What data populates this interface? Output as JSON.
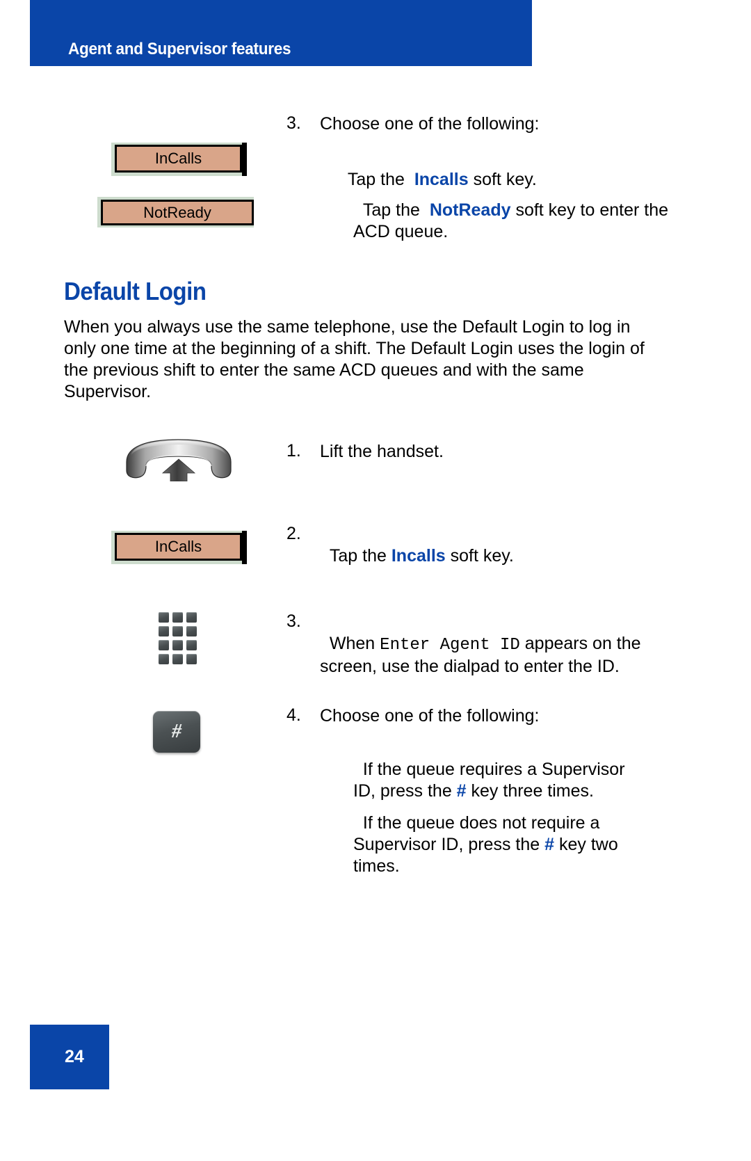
{
  "header": {
    "title": "Agent and Supervisor features",
    "bar_color": "#0A45A8"
  },
  "top_step": {
    "number": "3.",
    "text": "Choose one of the following:",
    "bullets": [
      {
        "prefix": "Tap the  ",
        "highlight": "Incalls",
        "suffix": " soft key."
      },
      {
        "prefix": "Tap the  ",
        "highlight": "NotReady",
        "suffix": " soft key to enter the ACD queue."
      }
    ]
  },
  "softkeys": {
    "incalls_top": "InCalls",
    "notready": "NotReady",
    "incalls_mid": "InCalls"
  },
  "section": {
    "heading": "Default Login",
    "heading_color": "#0A45A8",
    "paragraph": "When you always use the same telephone, use the Default Login to log in only one time at the beginning of a shift. The Default Login uses the login of the previous shift to enter the same ACD queues and with the same Supervisor."
  },
  "steps": [
    {
      "number": "1.",
      "text": "Lift the handset.",
      "icon": "handset-lift-icon"
    },
    {
      "number": "2.",
      "prefix": "Tap the ",
      "highlight": "Incalls",
      "suffix": " soft key.",
      "icon": "softkey-incalls-icon"
    },
    {
      "number": "3.",
      "prefix": "When ",
      "mono": "Enter Agent ID",
      "suffix": " appears on the screen, use the dialpad to enter the ID.",
      "icon": "dialpad-icon"
    },
    {
      "number": "4.",
      "text": "Choose one of the following:",
      "icon": "hash-key-icon",
      "bullets": [
        {
          "prefix": "If the queue requires a Supervisor ID, press the ",
          "highlight": "#",
          "suffix": " key three times."
        },
        {
          "prefix": "If the queue does not require a Supervisor ID, press the ",
          "highlight": "#",
          "suffix": " key two times."
        }
      ]
    }
  ],
  "hash_glyph": "#",
  "footer": {
    "page_number": "24",
    "box_color": "#0A45A8"
  }
}
